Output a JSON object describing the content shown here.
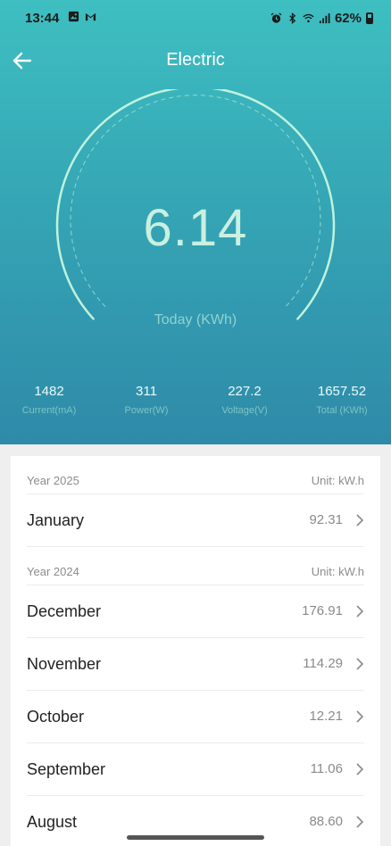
{
  "status_bar": {
    "time": "13:44",
    "battery_percent": "62%",
    "left_icons": [
      "image-icon",
      "gmail-icon"
    ],
    "right_icons": [
      "alarm-icon",
      "bluetooth-icon",
      "wifi-icon",
      "signal-icon",
      "battery-icon"
    ]
  },
  "header": {
    "title": "Electric",
    "back_icon": "back-arrow-icon"
  },
  "gauge": {
    "value": "6.14",
    "label": "Today (KWh)"
  },
  "stats": [
    {
      "value": "1482",
      "label": "Current(mA)"
    },
    {
      "value": "311",
      "label": "Power(W)"
    },
    {
      "value": "227.2",
      "label": "Voltage(V)"
    },
    {
      "value": "1657.52",
      "label": "Total (KWh)"
    }
  ],
  "history": [
    {
      "year": "Year 2025",
      "unit": "Unit: kW.h",
      "months": [
        {
          "month": "January",
          "value": "92.31"
        }
      ]
    },
    {
      "year": "Year 2024",
      "unit": "Unit: kW.h",
      "months": [
        {
          "month": "December",
          "value": "176.91"
        },
        {
          "month": "November",
          "value": "114.29"
        },
        {
          "month": "October",
          "value": "12.21"
        },
        {
          "month": "September",
          "value": "11.06"
        },
        {
          "month": "August",
          "value": "88.60"
        }
      ]
    }
  ],
  "colors": {
    "hero_top": "#3ebfc1",
    "hero_bottom": "#2f8aa9",
    "gauge_stroke": "#bff3dd",
    "reading": "#c9f0e1"
  }
}
